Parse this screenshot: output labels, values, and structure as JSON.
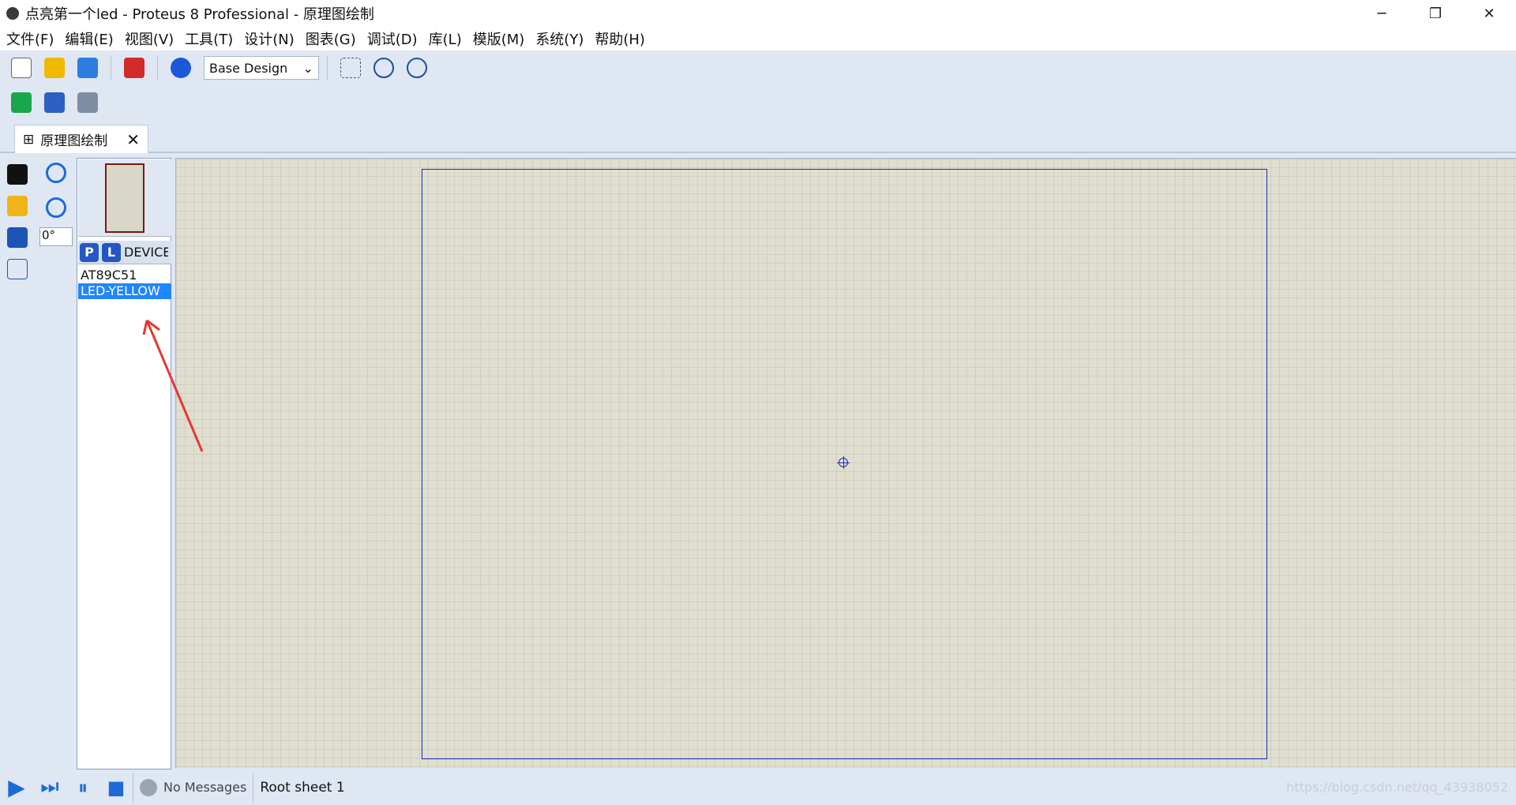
{
  "window": {
    "title": "点亮第一个led - Proteus 8 Professional - 原理图绘制",
    "controls": [
      "─",
      "❐",
      "✕"
    ]
  },
  "menu": [
    "文件(F)",
    "编辑(E)",
    "视图(V)",
    "工具(T)",
    "设计(N)",
    "图表(G)",
    "调试(D)",
    "库(L)",
    "模版(M)",
    "系统(Y)",
    "帮助(H)"
  ],
  "toolbar": {
    "design_select": "Base Design"
  },
  "tab": {
    "label": "原理图绘制",
    "close": "✕"
  },
  "left_tools": {
    "rotation": "0°"
  },
  "object_panel": {
    "p_button": "P",
    "l_button": "L",
    "devices_label": "DEVICES",
    "devices": [
      "AT89C51",
      "LED-YELLOW"
    ],
    "selected_index": 1
  },
  "status": {
    "messages": "No Messages",
    "sheet": "Root sheet 1",
    "watermark": "https://blog.csdn.net/qq_43938052"
  },
  "colors": {
    "ui_bg": "#dfe7f3",
    "canvas_bg": "#e0dfcf",
    "sheet_border": "#1b2ab8",
    "selection": "#1f86ff",
    "arrow": "#e53935"
  }
}
